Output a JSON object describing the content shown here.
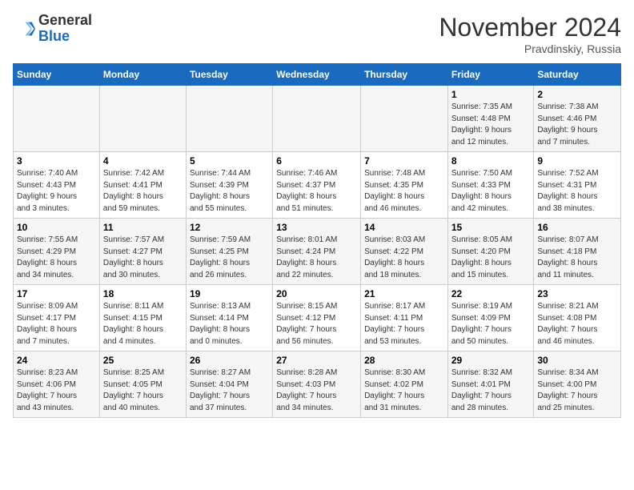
{
  "logo": {
    "line1": "General",
    "line2": "Blue"
  },
  "title": "November 2024",
  "location": "Pravdinskiy, Russia",
  "weekdays": [
    "Sunday",
    "Monday",
    "Tuesday",
    "Wednesday",
    "Thursday",
    "Friday",
    "Saturday"
  ],
  "rows": [
    [
      {
        "day": "",
        "info": ""
      },
      {
        "day": "",
        "info": ""
      },
      {
        "day": "",
        "info": ""
      },
      {
        "day": "",
        "info": ""
      },
      {
        "day": "",
        "info": ""
      },
      {
        "day": "1",
        "info": "Sunrise: 7:35 AM\nSunset: 4:48 PM\nDaylight: 9 hours\nand 12 minutes."
      },
      {
        "day": "2",
        "info": "Sunrise: 7:38 AM\nSunset: 4:46 PM\nDaylight: 9 hours\nand 7 minutes."
      }
    ],
    [
      {
        "day": "3",
        "info": "Sunrise: 7:40 AM\nSunset: 4:43 PM\nDaylight: 9 hours\nand 3 minutes."
      },
      {
        "day": "4",
        "info": "Sunrise: 7:42 AM\nSunset: 4:41 PM\nDaylight: 8 hours\nand 59 minutes."
      },
      {
        "day": "5",
        "info": "Sunrise: 7:44 AM\nSunset: 4:39 PM\nDaylight: 8 hours\nand 55 minutes."
      },
      {
        "day": "6",
        "info": "Sunrise: 7:46 AM\nSunset: 4:37 PM\nDaylight: 8 hours\nand 51 minutes."
      },
      {
        "day": "7",
        "info": "Sunrise: 7:48 AM\nSunset: 4:35 PM\nDaylight: 8 hours\nand 46 minutes."
      },
      {
        "day": "8",
        "info": "Sunrise: 7:50 AM\nSunset: 4:33 PM\nDaylight: 8 hours\nand 42 minutes."
      },
      {
        "day": "9",
        "info": "Sunrise: 7:52 AM\nSunset: 4:31 PM\nDaylight: 8 hours\nand 38 minutes."
      }
    ],
    [
      {
        "day": "10",
        "info": "Sunrise: 7:55 AM\nSunset: 4:29 PM\nDaylight: 8 hours\nand 34 minutes."
      },
      {
        "day": "11",
        "info": "Sunrise: 7:57 AM\nSunset: 4:27 PM\nDaylight: 8 hours\nand 30 minutes."
      },
      {
        "day": "12",
        "info": "Sunrise: 7:59 AM\nSunset: 4:25 PM\nDaylight: 8 hours\nand 26 minutes."
      },
      {
        "day": "13",
        "info": "Sunrise: 8:01 AM\nSunset: 4:24 PM\nDaylight: 8 hours\nand 22 minutes."
      },
      {
        "day": "14",
        "info": "Sunrise: 8:03 AM\nSunset: 4:22 PM\nDaylight: 8 hours\nand 18 minutes."
      },
      {
        "day": "15",
        "info": "Sunrise: 8:05 AM\nSunset: 4:20 PM\nDaylight: 8 hours\nand 15 minutes."
      },
      {
        "day": "16",
        "info": "Sunrise: 8:07 AM\nSunset: 4:18 PM\nDaylight: 8 hours\nand 11 minutes."
      }
    ],
    [
      {
        "day": "17",
        "info": "Sunrise: 8:09 AM\nSunset: 4:17 PM\nDaylight: 8 hours\nand 7 minutes."
      },
      {
        "day": "18",
        "info": "Sunrise: 8:11 AM\nSunset: 4:15 PM\nDaylight: 8 hours\nand 4 minutes."
      },
      {
        "day": "19",
        "info": "Sunrise: 8:13 AM\nSunset: 4:14 PM\nDaylight: 8 hours\nand 0 minutes."
      },
      {
        "day": "20",
        "info": "Sunrise: 8:15 AM\nSunset: 4:12 PM\nDaylight: 7 hours\nand 56 minutes."
      },
      {
        "day": "21",
        "info": "Sunrise: 8:17 AM\nSunset: 4:11 PM\nDaylight: 7 hours\nand 53 minutes."
      },
      {
        "day": "22",
        "info": "Sunrise: 8:19 AM\nSunset: 4:09 PM\nDaylight: 7 hours\nand 50 minutes."
      },
      {
        "day": "23",
        "info": "Sunrise: 8:21 AM\nSunset: 4:08 PM\nDaylight: 7 hours\nand 46 minutes."
      }
    ],
    [
      {
        "day": "24",
        "info": "Sunrise: 8:23 AM\nSunset: 4:06 PM\nDaylight: 7 hours\nand 43 minutes."
      },
      {
        "day": "25",
        "info": "Sunrise: 8:25 AM\nSunset: 4:05 PM\nDaylight: 7 hours\nand 40 minutes."
      },
      {
        "day": "26",
        "info": "Sunrise: 8:27 AM\nSunset: 4:04 PM\nDaylight: 7 hours\nand 37 minutes."
      },
      {
        "day": "27",
        "info": "Sunrise: 8:28 AM\nSunset: 4:03 PM\nDaylight: 7 hours\nand 34 minutes."
      },
      {
        "day": "28",
        "info": "Sunrise: 8:30 AM\nSunset: 4:02 PM\nDaylight: 7 hours\nand 31 minutes."
      },
      {
        "day": "29",
        "info": "Sunrise: 8:32 AM\nSunset: 4:01 PM\nDaylight: 7 hours\nand 28 minutes."
      },
      {
        "day": "30",
        "info": "Sunrise: 8:34 AM\nSunset: 4:00 PM\nDaylight: 7 hours\nand 25 minutes."
      }
    ]
  ]
}
